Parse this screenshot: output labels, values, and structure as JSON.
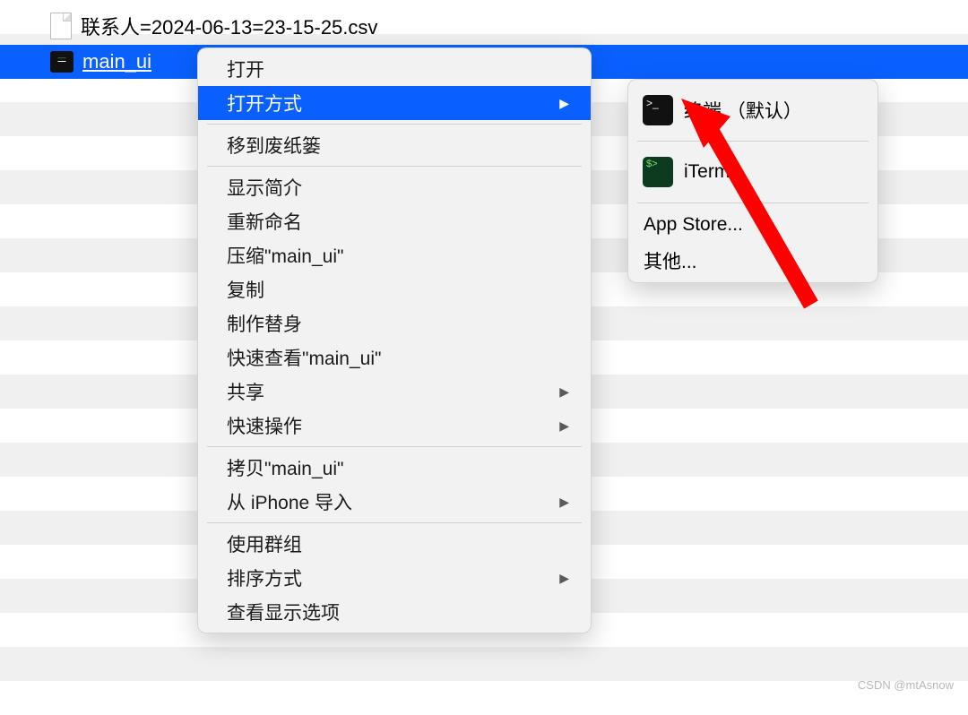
{
  "files": {
    "csv": {
      "name": "联系人=2024-06-13=23-15-25.csv"
    },
    "selected": {
      "name": "main_ui"
    }
  },
  "context_menu": {
    "open": "打开",
    "open_with": "打开方式",
    "move_to_trash": "移到废纸篓",
    "get_info": "显示简介",
    "rename": "重新命名",
    "compress": "压缩\"main_ui\"",
    "duplicate": "复制",
    "make_alias": "制作替身",
    "quick_look": "快速查看\"main_ui\"",
    "share": "共享",
    "quick_actions": "快速操作",
    "copy": "拷贝\"main_ui\"",
    "import_iphone": "从 iPhone 导入",
    "use_groups": "使用群组",
    "sort_by": "排序方式",
    "show_view_options": "查看显示选项"
  },
  "submenu": {
    "terminal": "终端 （默认）",
    "iterm": "iTerm",
    "app_store": "App Store...",
    "other": "其他..."
  },
  "watermark": "CSDN @mtAsnow"
}
